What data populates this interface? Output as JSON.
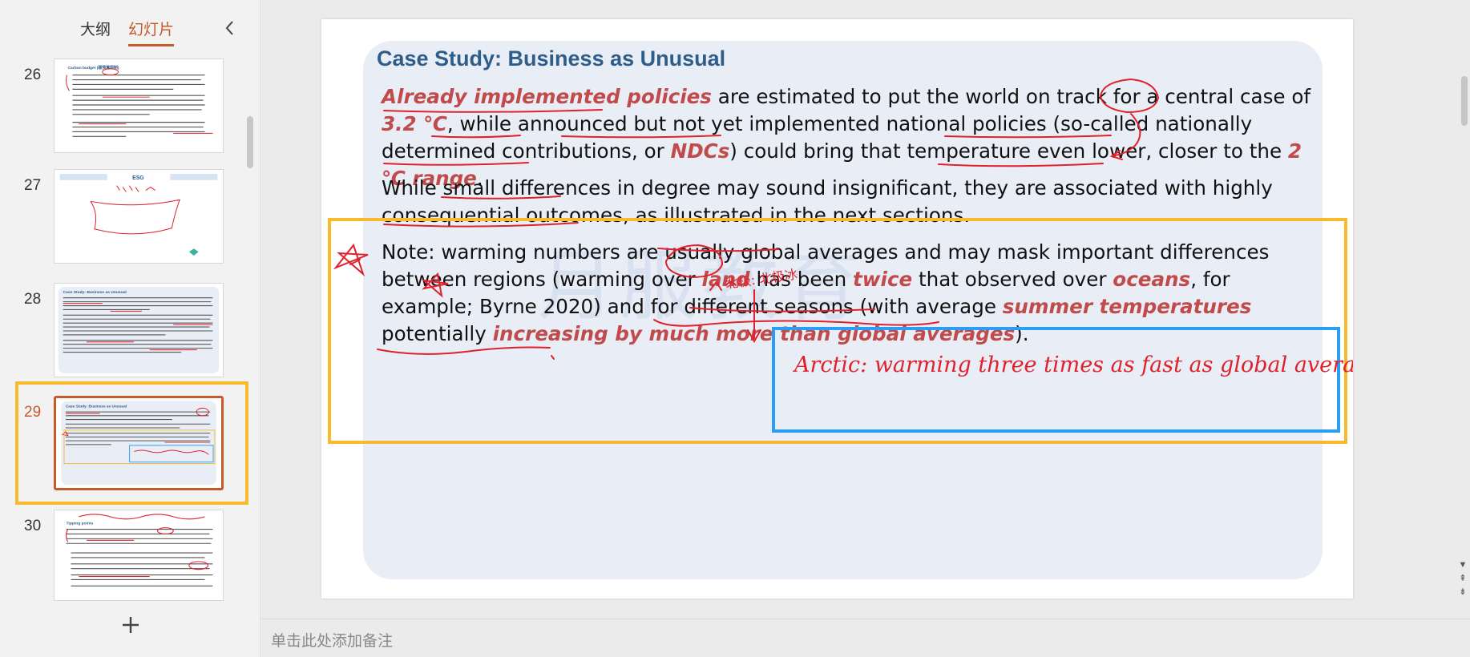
{
  "panel": {
    "tabs": [
      {
        "label": "大纲",
        "active": false
      },
      {
        "label": "幻灯片",
        "active": true
      }
    ]
  },
  "thumbnails": [
    {
      "number": "26",
      "title": "Carbon budget (碳预算限制)"
    },
    {
      "number": "27",
      "title": "ESG"
    },
    {
      "number": "28",
      "title": "Case Study: Business as Unusual"
    },
    {
      "number": "29",
      "title": "Case Study: Business as Unusual",
      "selected": true
    },
    {
      "number": "30",
      "title": "Tipping points"
    }
  ],
  "slide": {
    "title": "Case Study: Business as Unusual",
    "watermark": "月服教育",
    "p1": {
      "a": "Already implemented policies",
      "b": " are estimated to put the world on track for a central case of ",
      "c": "3.2 ℃",
      "d": ", while announced but not yet implemented national policies (so-called nationally determined contributions, or ",
      "e": "NDCs",
      "f": ") could bring that temperature even lower, closer to the ",
      "g": "2 ℃ range",
      "h": "."
    },
    "p2": "While small differences in degree may sound insignificant, they are associated with highly consequential outcomes, as illustrated in the next sections.",
    "p3": {
      "a": "Note: warming numbers are usually global averages and may mask important differences between regions (warming over ",
      "b": "land",
      "c": " has been ",
      "d": "twice",
      "e": " that observed over ",
      "f": "oceans",
      "g": ", for example; Byrne 2020) and for different seasons (with average ",
      "h": "summer temperatures",
      "i": " potentially ",
      "j": "increasing by much more than global averages",
      "k": ")."
    },
    "handwriting": {
      "arctic_note": "Arctic:  warming three times as fast as global average.",
      "annotation_top": "北极: 北极冰"
    }
  },
  "notes_placeholder": "单击此处添加备注",
  "colors": {
    "accent": "#c55a2a",
    "selection_frame": "#f9b92c",
    "title_blue": "#2f5d8a",
    "emphasis_red": "#c14a4a",
    "ink_red": "#e0202a",
    "box_yellow": "#f9b92c",
    "box_blue": "#2a9df4"
  },
  "icons": [
    "chevron-left-icon",
    "plus-icon",
    "scroll-down-arrow-icon",
    "page-up-icon",
    "page-down-icon"
  ]
}
